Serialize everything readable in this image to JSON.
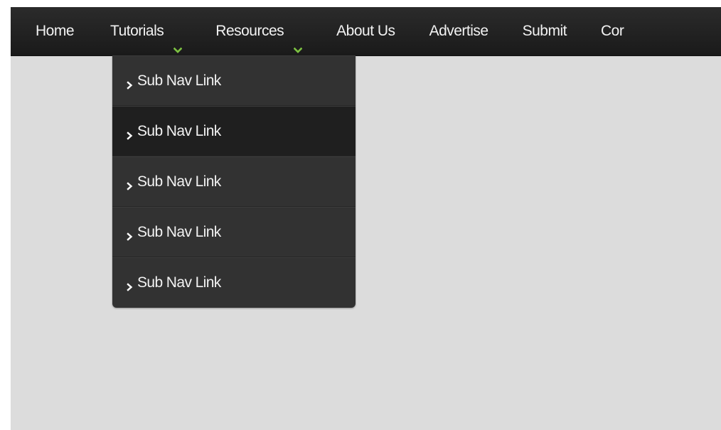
{
  "nav": {
    "items": [
      {
        "label": "Home",
        "has_chevron": false
      },
      {
        "label": "Tutorials",
        "has_chevron": true
      },
      {
        "label": "Resources",
        "has_chevron": true
      },
      {
        "label": "About Us",
        "has_chevron": false
      },
      {
        "label": "Advertise",
        "has_chevron": false
      },
      {
        "label": "Submit",
        "has_chevron": false
      },
      {
        "label": "Cor",
        "has_chevron": false
      }
    ],
    "chevron_icon": "chevron-down-icon",
    "chevron_color": "#7dc242"
  },
  "dropdown": {
    "parent": "Tutorials",
    "items": [
      {
        "label": "Sub Nav Link"
      },
      {
        "label": "Sub Nav Link"
      },
      {
        "label": "Sub Nav Link"
      },
      {
        "label": "Sub Nav Link"
      },
      {
        "label": "Sub Nav Link"
      }
    ],
    "item_icon": "chevron-right-icon",
    "hovered_index": 1
  },
  "colors": {
    "navbar": "#222222",
    "dropdown": "#323232",
    "dropdown_hover": "#1f1f1f",
    "page": "#dcdcdc",
    "text": "#f2f2f2"
  }
}
